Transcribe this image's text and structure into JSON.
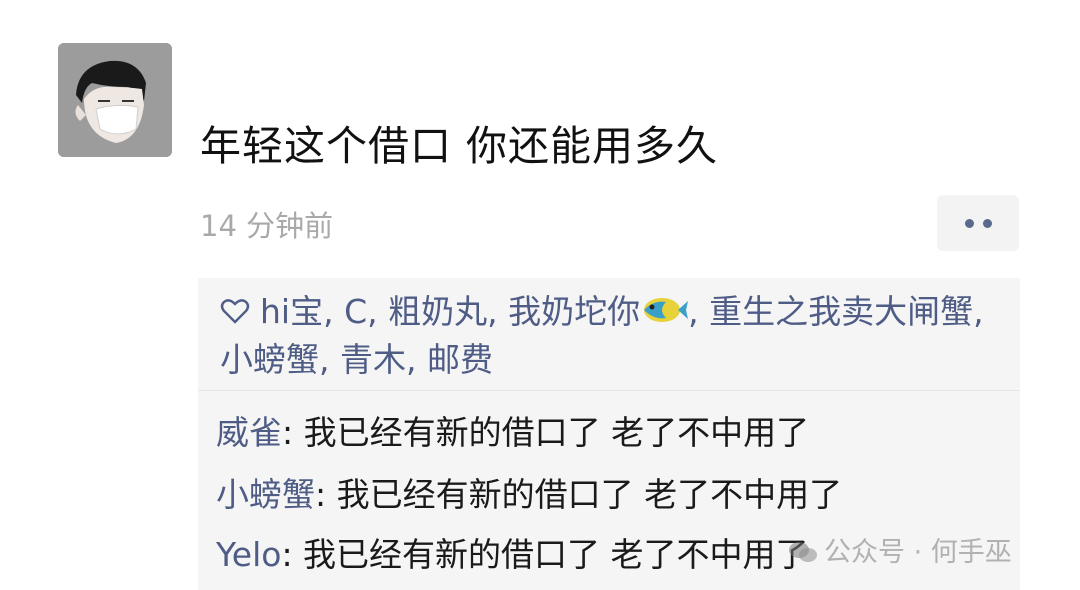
{
  "post": {
    "text": "年轻这个借口 你还能用多久",
    "timestamp": "14 分钟前"
  },
  "likes": {
    "names": [
      "hi宝",
      "C",
      "粗奶丸",
      "我奶坨你",
      "重生之我卖大闸蟹",
      "小螃蟹",
      "青木",
      "邮费"
    ],
    "separator": ", "
  },
  "comments": [
    {
      "author": "威雀",
      "text": "我已经有新的借口了 老了不中用了"
    },
    {
      "author": "小螃蟹",
      "text": "我已经有新的借口了 老了不中用了"
    },
    {
      "author": "Yelo",
      "text": "我已经有新的借口了 老了不中用了"
    }
  ],
  "comment_colon": ": ",
  "watermark": {
    "text": "公众号 · 何手巫"
  },
  "colors": {
    "name_blue": "#4f5d86",
    "box_bg": "#f5f5f5",
    "timestamp_gray": "#a9a9a9"
  },
  "icons": {
    "avatar": "masked-man-avatar",
    "more": "more-dots-icon",
    "like": "heart-icon",
    "emoji": "fish-emoji"
  }
}
